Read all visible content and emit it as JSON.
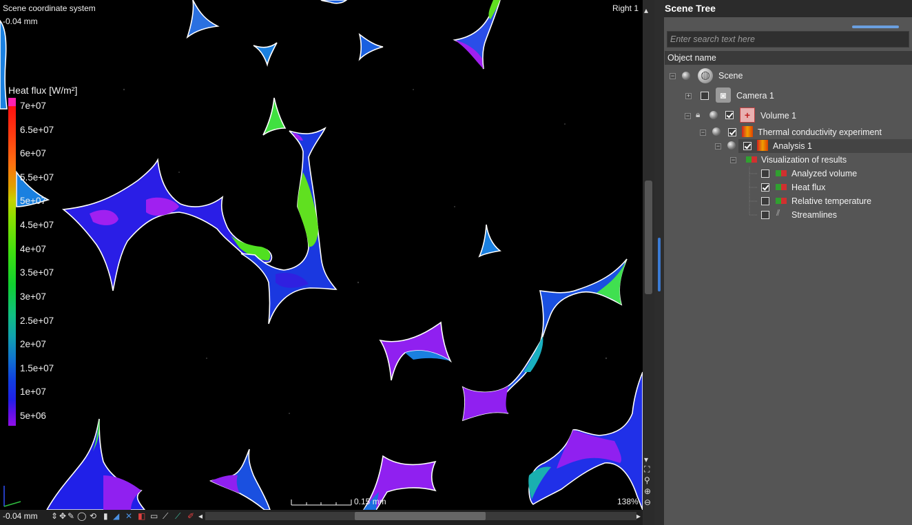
{
  "viewport": {
    "coord_system_label": "Scene coordinate system",
    "coord_value": "-0.04 mm",
    "view_name": "Right 1",
    "zoom": "138%",
    "scale_bar_label": "0.15 mm"
  },
  "legend": {
    "title": "Heat flux [W/m²]",
    "ticks": [
      "7e+07",
      "6.5e+07",
      "6e+07",
      "5.5e+07",
      "5e+07",
      "4.5e+07",
      "4e+07",
      "3.5e+07",
      "3e+07",
      "2.5e+07",
      "2e+07",
      "1.5e+07",
      "1e+07",
      "5e+06"
    ]
  },
  "bottom_toolbar": {
    "coord_field_value": "-0.04 mm"
  },
  "scene_tree": {
    "title": "Scene Tree",
    "search_placeholder": "Enter search text here",
    "column_header": "Object name",
    "items": [
      {
        "label": "Scene",
        "checked": null
      },
      {
        "label": "Camera 1",
        "checked": false
      },
      {
        "label": "Volume 1",
        "checked": true
      },
      {
        "label": "Thermal conductivity experiment",
        "checked": true
      },
      {
        "label": "Analysis 1",
        "checked": true
      },
      {
        "label": "Visualization of results",
        "checked": null
      },
      {
        "label": "Analyzed volume",
        "checked": false
      },
      {
        "label": "Heat flux",
        "checked": true
      },
      {
        "label": "Relative temperature",
        "checked": false
      },
      {
        "label": "Streamlines",
        "checked": false
      }
    ]
  },
  "colors": {
    "panel_bg": "#555555",
    "viewport_bg": "#000000",
    "accent": "#6a9fe0"
  }
}
